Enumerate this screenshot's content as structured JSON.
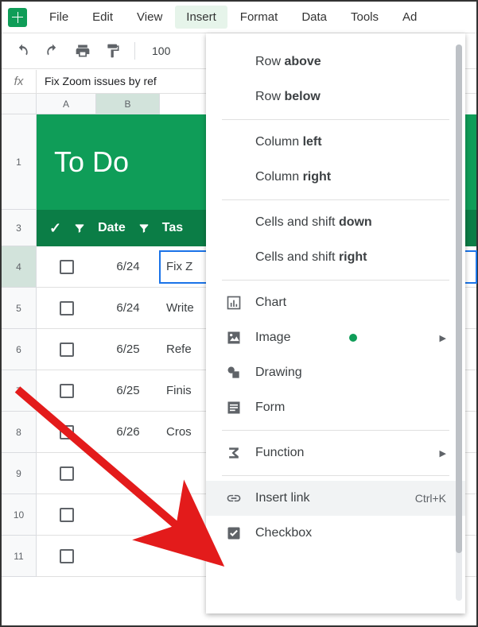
{
  "menubar": {
    "items": [
      "File",
      "Edit",
      "View",
      "Insert",
      "Format",
      "Data",
      "Tools",
      "Ad"
    ]
  },
  "toolbar": {
    "zoom": "100"
  },
  "formula_bar": {
    "label": "fx",
    "value": "Fix Zoom issues by ref"
  },
  "columns": [
    "A",
    "B"
  ],
  "row_numbers": [
    "1",
    "3",
    "4",
    "5",
    "6",
    "7",
    "8",
    "9",
    "10",
    "11"
  ],
  "sheet": {
    "title": "To Do",
    "headers": {
      "date": "Date",
      "task": "Tas"
    },
    "rows": [
      {
        "date": "6/24",
        "task": "Fix Z",
        "selected": true
      },
      {
        "date": "6/24",
        "task": "Write"
      },
      {
        "date": "6/25",
        "task": "Refe"
      },
      {
        "date": "6/25",
        "task": "Finis"
      },
      {
        "date": "6/26",
        "task": "Cros"
      },
      {
        "date": "",
        "task": ""
      },
      {
        "date": "",
        "task": ""
      },
      {
        "date": "",
        "task": ""
      }
    ]
  },
  "insert_menu": {
    "groups": [
      [
        {
          "label_pre": "Row ",
          "label_bold": "above"
        },
        {
          "label_pre": "Row ",
          "label_bold": "below"
        }
      ],
      [
        {
          "label_pre": "Column ",
          "label_bold": "left"
        },
        {
          "label_pre": "Column ",
          "label_bold": "right"
        }
      ],
      [
        {
          "label_pre": "Cells and shift ",
          "label_bold": "down"
        },
        {
          "label_pre": "Cells and shift ",
          "label_bold": "right"
        }
      ],
      [
        {
          "icon": "chart-icon",
          "label": "Chart"
        },
        {
          "icon": "image-icon",
          "label": "Image",
          "dot": true,
          "submenu": true
        },
        {
          "icon": "drawing-icon",
          "label": "Drawing"
        },
        {
          "icon": "form-icon",
          "label": "Form"
        }
      ],
      [
        {
          "icon": "function-icon",
          "label": "Function",
          "submenu": true
        }
      ],
      [
        {
          "icon": "link-icon",
          "label": "Insert link",
          "shortcut": "Ctrl+K",
          "hover": true
        },
        {
          "icon": "checkbox-icon",
          "label": "Checkbox"
        }
      ]
    ]
  }
}
